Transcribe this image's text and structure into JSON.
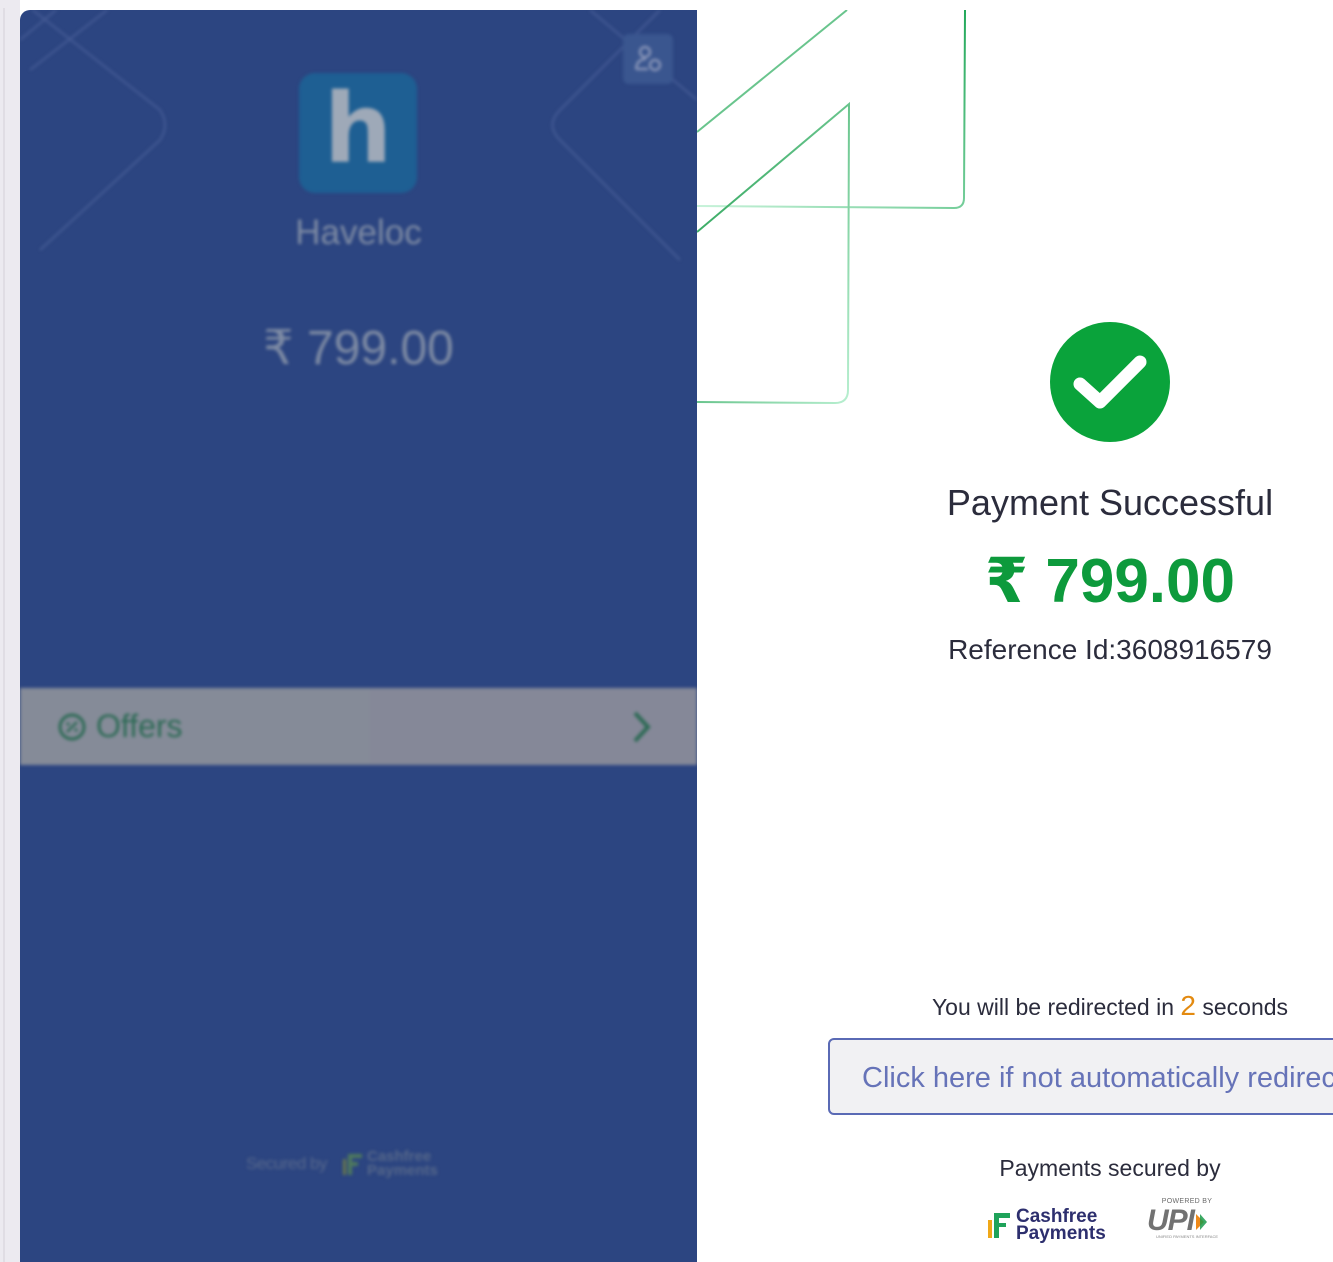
{
  "merchant": {
    "logo_letter": "h",
    "name": "Haveloc",
    "amount": "₹ 799.00"
  },
  "offers": {
    "label": "Offers"
  },
  "left_footer": {
    "secured_text": "Secured by",
    "brand_line1": "Cashfree",
    "brand_line2": "Payments"
  },
  "status": {
    "title": "Payment Successful",
    "amount": "₹ 799.00",
    "reference": "Reference Id:3608916579"
  },
  "redirect": {
    "prefix": "You will be redirected in",
    "seconds": "2",
    "suffix": "seconds",
    "button_label": "Click here if not automatically redirected"
  },
  "footer": {
    "secured_by": "Payments secured by",
    "cashfree_line1": "Cashfree",
    "cashfree_line2": "Payments",
    "upi_powered": "POWERED BY",
    "upi_word": "UPI",
    "upi_sub": "UNIFIED PAYMENTS INTERFACE"
  },
  "colors": {
    "panel_bg": "#2c4581",
    "success_green": "#0d9a3c",
    "countdown_orange": "#e38a10",
    "button_border": "#5a6ab5"
  },
  "icons": [
    "profile-icon",
    "offer-tag-icon",
    "chevron-right-icon",
    "checkmark-icon"
  ]
}
